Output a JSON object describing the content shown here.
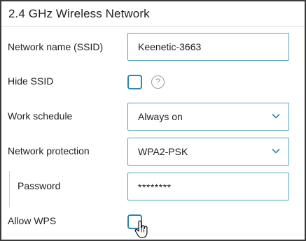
{
  "section": {
    "title": "2.4 GHz Wireless Network"
  },
  "fields": {
    "ssid": {
      "label": "Network name (SSID)",
      "value": "Keenetic-3663"
    },
    "hide_ssid": {
      "label": "Hide SSID",
      "checked": false,
      "help_glyph": "?"
    },
    "schedule": {
      "label": "Work schedule",
      "value": "Always on"
    },
    "protection": {
      "label": "Network protection",
      "value": "WPA2-PSK"
    },
    "password": {
      "label": "Password",
      "value": "********"
    },
    "wps": {
      "label": "Allow WPS",
      "checked": false
    }
  },
  "colors": {
    "accent": "#4aa6bf",
    "checkbox_border": "#2a86b3",
    "chevron": "#2a86b3"
  },
  "icons": {
    "select": "chevron-down-icon",
    "help": "help-icon",
    "cursor": "hand-pointer-icon"
  }
}
